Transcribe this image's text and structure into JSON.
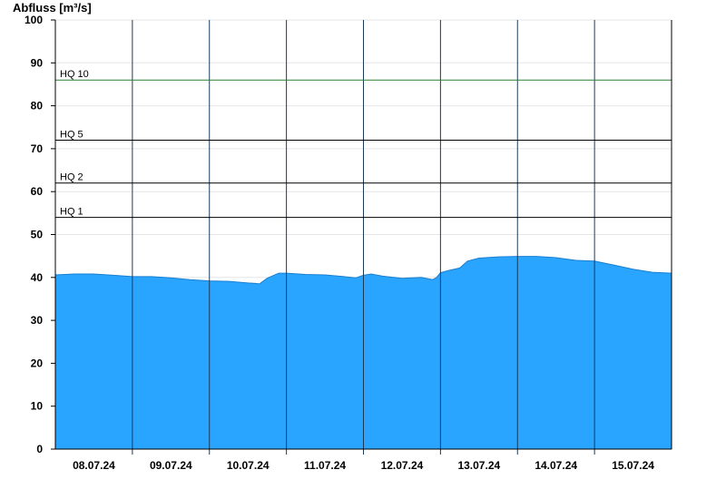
{
  "chart_data": {
    "type": "area",
    "ylabel": "Abfluss [m³/s]",
    "ylim": [
      0,
      100
    ],
    "yticks": [
      0,
      10,
      20,
      30,
      40,
      50,
      60,
      70,
      80,
      90,
      100
    ],
    "x_start": "07.07.24 00:00",
    "x_end": "15.07.24 24:00",
    "day_labels": [
      "08.07.24",
      "09.07.24",
      "10.07.24",
      "11.07.24",
      "12.07.24",
      "13.07.24",
      "14.07.24",
      "15.07.24"
    ],
    "grid": true,
    "fill_color": "#2aa5ff",
    "thresholds": [
      {
        "label": "HQ 1",
        "value": 54,
        "color": "#000000"
      },
      {
        "label": "HQ 2",
        "value": 62,
        "color": "#000000"
      },
      {
        "label": "HQ 5",
        "value": 72,
        "color": "#000000"
      },
      {
        "label": "HQ 10",
        "value": 86,
        "color": "#2e7d32"
      }
    ],
    "series": [
      {
        "x": [
          0,
          0.25,
          0.5,
          0.75,
          1.0,
          1.25,
          1.5,
          1.75,
          2.0,
          2.25,
          2.5,
          2.6,
          2.65,
          2.75,
          2.9,
          3.0,
          3.25,
          3.5,
          3.75,
          3.9,
          4.0,
          4.1,
          4.25,
          4.5,
          4.75,
          4.9,
          4.95,
          5.0,
          5.1,
          5.25,
          5.35,
          5.5,
          5.75,
          6.0,
          6.25,
          6.5,
          6.75,
          7.0,
          7.25,
          7.5,
          7.75,
          8.0
        ],
        "values": [
          40.6,
          40.8,
          40.8,
          40.5,
          40.2,
          40.2,
          39.9,
          39.5,
          39.2,
          39.1,
          38.7,
          38.6,
          38.5,
          39.8,
          41.0,
          41.0,
          40.7,
          40.6,
          40.2,
          39.9,
          40.5,
          40.8,
          40.3,
          39.8,
          40.0,
          39.5,
          40.0,
          41.1,
          41.6,
          42.2,
          43.8,
          44.5,
          44.8,
          44.9,
          44.9,
          44.6,
          44.0,
          43.8,
          42.9,
          41.9,
          41.2,
          41.0
        ]
      }
    ]
  }
}
